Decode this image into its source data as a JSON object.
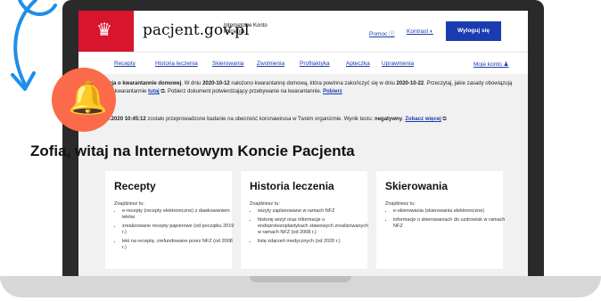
{
  "header": {
    "site_title": "pacjent.gov.pl",
    "site_subtitle": "Internetowe Konto Pacjenta",
    "help": "Pomoc ⓘ",
    "contrast": "Kontrast ◐",
    "logout": "Wyloguj się"
  },
  "nav": {
    "items": [
      "Recepty",
      "Historia leczenia",
      "Skierowania",
      "Zwolnienia",
      "Profilaktyka",
      "Apteczka",
      "Uprawnienia"
    ],
    "account": "Moje konto ♟"
  },
  "notice1": {
    "title": "Decyzja o kwarantannie domowej",
    "t1": ". W dniu ",
    "date1": "2020-10-12",
    "t2": " nałożono kwarantannę domową, która powinna zakończyć się w dniu ",
    "date2": "2020-10-22",
    "t3": ". Przeczytaj, jakie zasady obowiązują Cię, na kwarantannie ",
    "link1": "tutaj",
    "t4": ". Pobierz dokument potwierdzający przebywanie na kwarantannie. ",
    "link2": "Pobierz"
  },
  "notice2": {
    "datetime": "13.10.2020 10:45:12",
    "t1": " zostało przeprowadzone badanie na obecność koronawirusa w Twoim organizmie. Wynik testu: ",
    "result": "negatywny",
    "t2": ". ",
    "link": "Zobacz więcej"
  },
  "welcome": "Zofia, witaj na Internetowym Koncie Pacjenta",
  "cards": [
    {
      "title": "Recepty",
      "lead": "Znajdziesz tu:",
      "items": [
        "e-recepty (recepty elektroniczne) z dawkowaniem leków",
        "zrealizowane recepty papierowe (od początku 2019 r.)",
        "leki na receptę, zrefundowane przez NFZ (od 2008 r.)"
      ]
    },
    {
      "title": "Historia leczenia",
      "lead": "Znajdziesz tu:",
      "items": [
        "wizyty zaplanowane w ramach NFZ",
        "historię wizyt oraz informacje o endoprotezoplastykach stawowych zrealizowanych w ramach NFZ (od 2008 r.)",
        "listę zdarzeń medycznych (od 2020 r.)"
      ]
    },
    {
      "title": "Skierowania",
      "lead": "Znajdziesz tu:",
      "items": [
        "e-skierowania (skierowania elektroniczne)",
        "informacje o skierowaniach do uzdrowisk w ramach NFZ"
      ]
    }
  ],
  "colors": {
    "brand_red": "#d7152d",
    "link_blue": "#1b3bb0",
    "bell_orange": "#fb6a4a",
    "arrow_blue": "#1f8ee8"
  },
  "icons": {
    "bell": "bell-icon",
    "arrow": "curved-arrow-icon",
    "eagle": "eagle-emblem-icon"
  }
}
